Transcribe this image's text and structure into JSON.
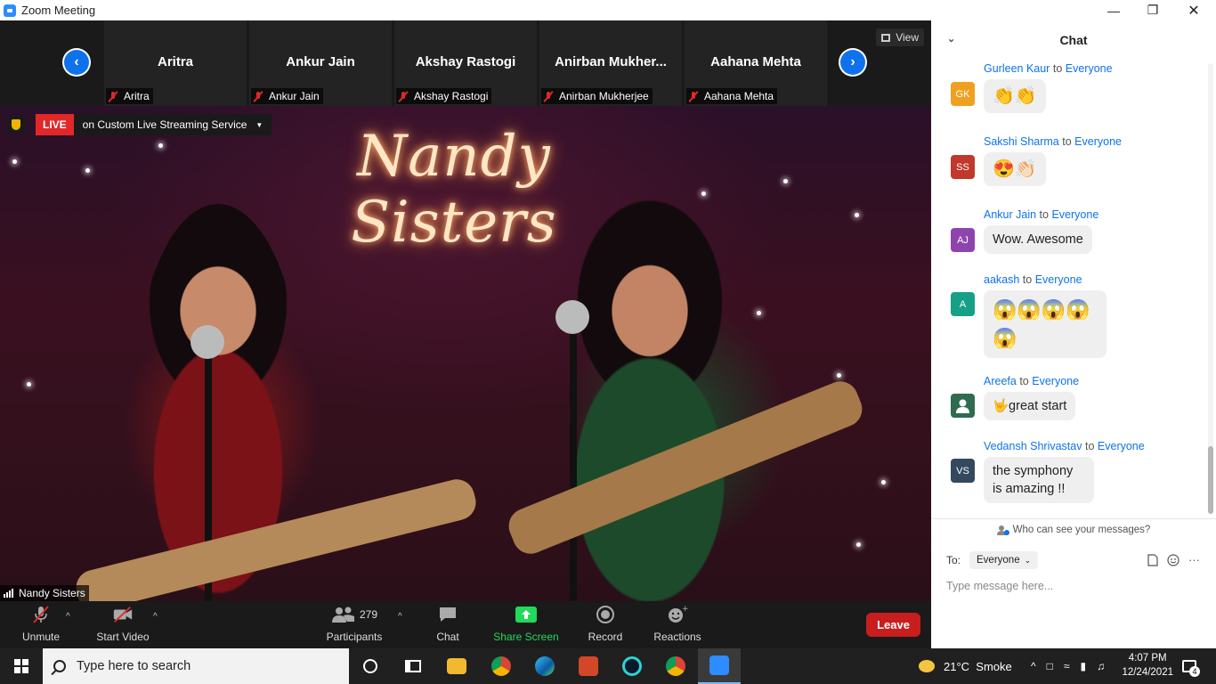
{
  "window": {
    "title": "Zoom Meeting"
  },
  "strip": {
    "participants": [
      {
        "display_name": "Aritra",
        "name_tag": "Aritra"
      },
      {
        "display_name": "Ankur Jain",
        "name_tag": "Ankur Jain"
      },
      {
        "display_name": "Akshay Rastogi",
        "name_tag": "Akshay Rastogi"
      },
      {
        "display_name": "Anirban  Mukher...",
        "name_tag": "Anirban Mukherjee"
      },
      {
        "display_name": "Aahana Mehta",
        "name_tag": "Aahana Mehta"
      }
    ],
    "view_label": "View"
  },
  "video": {
    "live_label": "LIVE",
    "live_service": "on Custom Live Streaming Service",
    "speaker_name": "Nandy Sisters",
    "neon_sign": "Nandy Sisters"
  },
  "toolbar": {
    "unmute": "Unmute",
    "start_video": "Start Video",
    "participants_count": "279",
    "participants": "Participants",
    "chat": "Chat",
    "share_screen": "Share Screen",
    "record": "Record",
    "reactions": "Reactions",
    "leave": "Leave"
  },
  "chat": {
    "title": "Chat",
    "messages": [
      {
        "initials": "GK",
        "color": "#F0A020",
        "sender": "Gurleen Kaur",
        "to": "to",
        "recipient": "Everyone",
        "text": "👏👏"
      },
      {
        "initials": "SS",
        "color": "#C0392B",
        "sender": "Sakshi Sharma",
        "to": "to",
        "recipient": "Everyone",
        "text": "😍👏🏻"
      },
      {
        "initials": "AJ",
        "color": "#8E44AD",
        "sender": "Ankur Jain",
        "to": "to",
        "recipient": "Everyone",
        "text": "Wow. Awesome"
      },
      {
        "initials": "A",
        "color": "#16A085",
        "sender": "aakash",
        "to": "to",
        "recipient": "Everyone",
        "text": "😱😱😱😱😱"
      },
      {
        "initials": "",
        "color": "#2E6B4F",
        "sender": "Areefa",
        "to": "to",
        "recipient": "Everyone",
        "text": "🤟great start"
      },
      {
        "initials": "VS",
        "color": "#34495E",
        "sender": "Vedansh Shrivastav",
        "to": "to",
        "recipient": "Everyone",
        "text": "the symphony is amazing !!"
      }
    ],
    "who_can_see": "Who can see your messages?",
    "to_label": "To:",
    "to_value": "Everyone",
    "input_placeholder": "Type message here..."
  },
  "taskbar": {
    "search_placeholder": "Type here to search",
    "weather": "21°C  Smoke",
    "time": "4:07 PM",
    "date": "12/24/2021",
    "notifications": "4"
  }
}
